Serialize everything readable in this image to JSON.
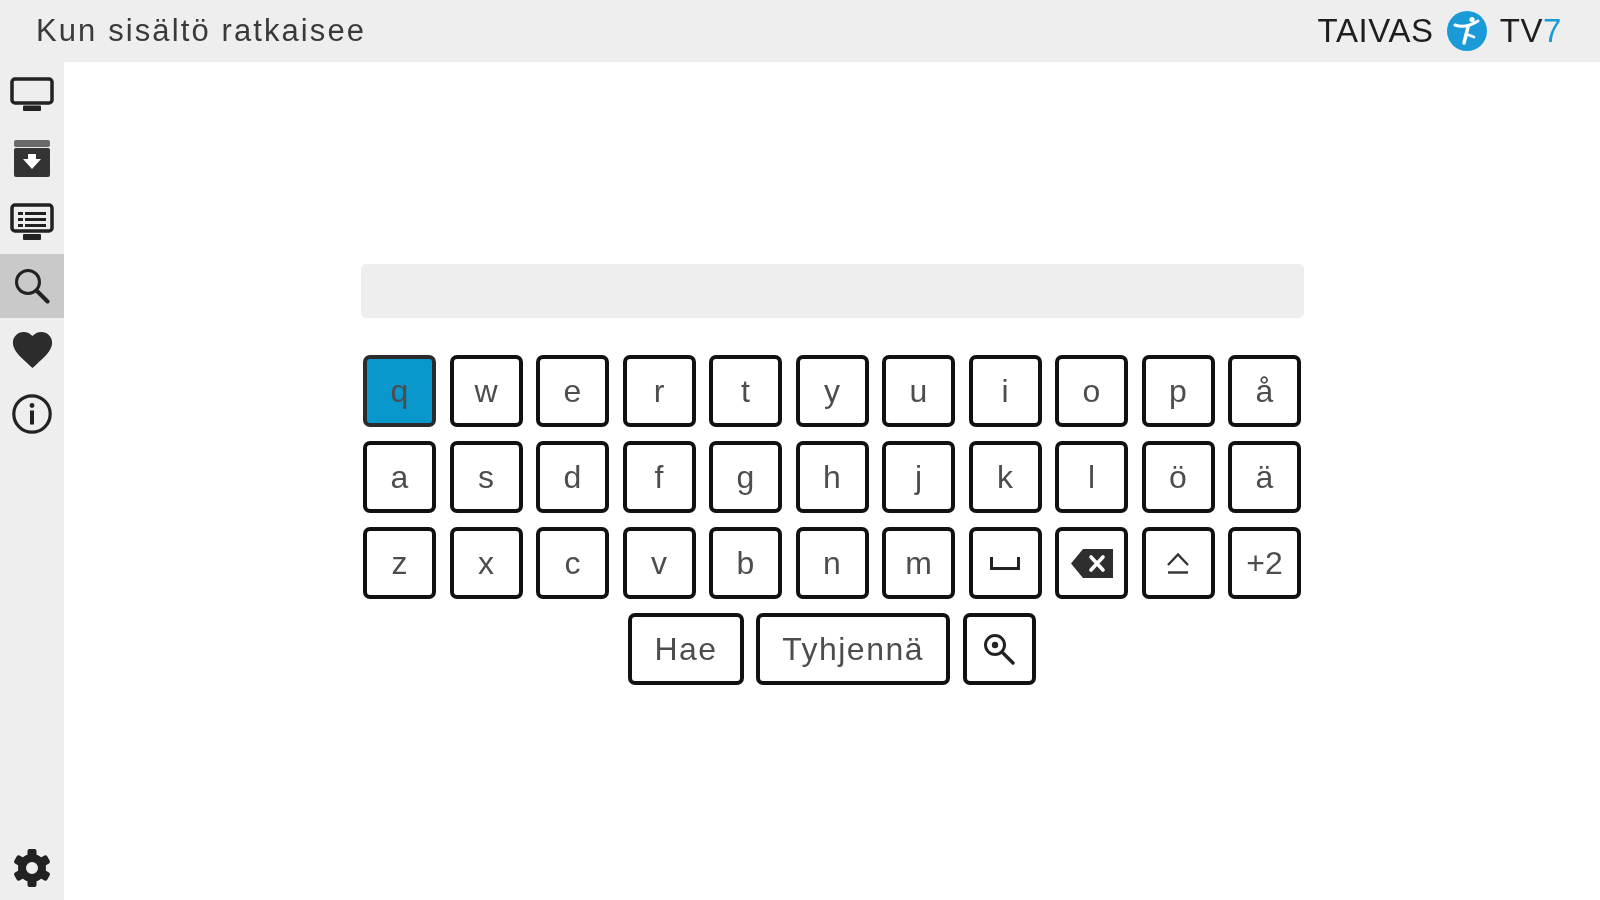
{
  "header": {
    "title": "Kun sisältö ratkaisee",
    "brand": {
      "name": "TAIVAS",
      "channel": "TV",
      "channel_number": "7"
    }
  },
  "sidebar": {
    "items": [
      {
        "kind": "tv",
        "selected": false
      },
      {
        "kind": "archive",
        "selected": false
      },
      {
        "kind": "guide",
        "selected": false
      },
      {
        "kind": "search",
        "selected": true
      },
      {
        "kind": "favorites",
        "selected": false
      },
      {
        "kind": "info",
        "selected": false
      }
    ],
    "bottom_items": [
      {
        "kind": "settings",
        "selected": false
      }
    ]
  },
  "keyboard": {
    "rows": [
      [
        {
          "kind": "char",
          "label": "q",
          "selected": true
        },
        {
          "kind": "char",
          "label": "w",
          "selected": false
        },
        {
          "kind": "char",
          "label": "e",
          "selected": false
        },
        {
          "kind": "char",
          "label": "r",
          "selected": false
        },
        {
          "kind": "char",
          "label": "t",
          "selected": false
        },
        {
          "kind": "char",
          "label": "y",
          "selected": false
        },
        {
          "kind": "char",
          "label": "u",
          "selected": false
        },
        {
          "kind": "char",
          "label": "i",
          "selected": false
        },
        {
          "kind": "char",
          "label": "o",
          "selected": false
        },
        {
          "kind": "char",
          "label": "p",
          "selected": false
        },
        {
          "kind": "char",
          "label": "å",
          "selected": false
        }
      ],
      [
        {
          "kind": "char",
          "label": "a",
          "selected": false
        },
        {
          "kind": "char",
          "label": "s",
          "selected": false
        },
        {
          "kind": "char",
          "label": "d",
          "selected": false
        },
        {
          "kind": "char",
          "label": "f",
          "selected": false
        },
        {
          "kind": "char",
          "label": "g",
          "selected": false
        },
        {
          "kind": "char",
          "label": "h",
          "selected": false
        },
        {
          "kind": "char",
          "label": "j",
          "selected": false
        },
        {
          "kind": "char",
          "label": "k",
          "selected": false
        },
        {
          "kind": "char",
          "label": "l",
          "selected": false
        },
        {
          "kind": "char",
          "label": "ö",
          "selected": false
        },
        {
          "kind": "char",
          "label": "ä",
          "selected": false
        }
      ],
      [
        {
          "kind": "char",
          "label": "z",
          "selected": false
        },
        {
          "kind": "char",
          "label": "x",
          "selected": false
        },
        {
          "kind": "char",
          "label": "c",
          "selected": false
        },
        {
          "kind": "char",
          "label": "v",
          "selected": false
        },
        {
          "kind": "char",
          "label": "b",
          "selected": false
        },
        {
          "kind": "char",
          "label": "n",
          "selected": false
        },
        {
          "kind": "char",
          "label": "m",
          "selected": false
        },
        {
          "kind": "space",
          "selected": false
        },
        {
          "kind": "backspace",
          "selected": false
        },
        {
          "kind": "shift",
          "selected": false
        },
        {
          "kind": "char",
          "label": "+2",
          "selected": false
        }
      ]
    ],
    "actions": [
      {
        "kind": "submit",
        "label": "Hae",
        "selected": false
      },
      {
        "kind": "clear",
        "label": "Tyhjennä",
        "selected": false
      },
      {
        "kind": "search",
        "selected": false
      }
    ]
  }
}
